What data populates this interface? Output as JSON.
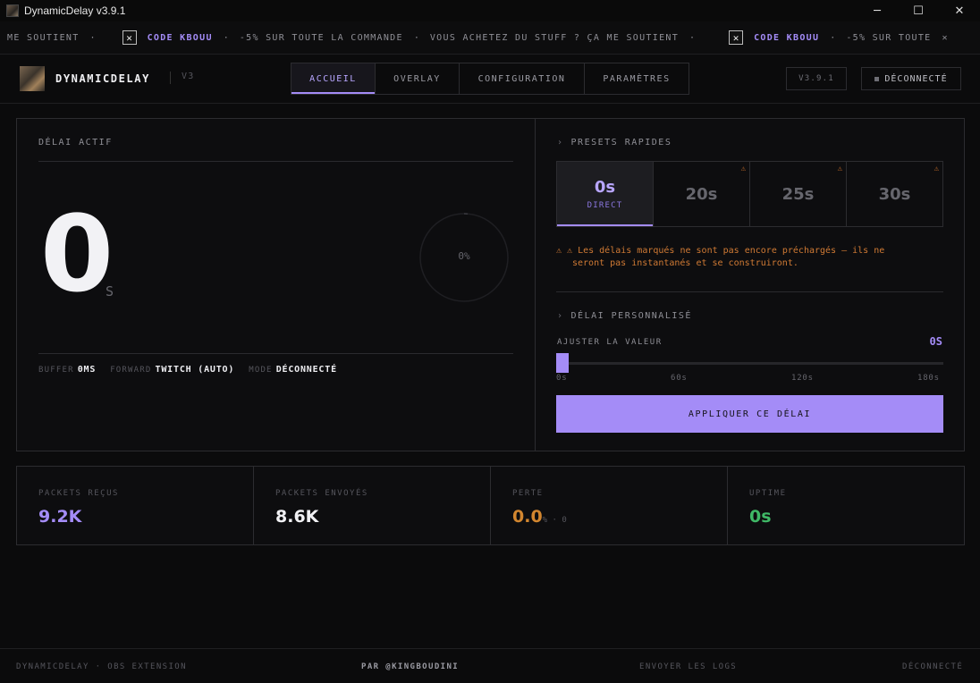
{
  "window": {
    "title": "DynamicDelay v3.9.1",
    "controls": {
      "minimize": "─",
      "maximize": "☐",
      "close": "✕"
    }
  },
  "ticker": {
    "lead": "ME SOUTIENT",
    "sep": "·",
    "code": "CODE KBOUU",
    "promo": "-5% SUR TOUTE LA COMMANDE",
    "support": "VOUS ACHETEZ DU STUFF ? ÇA ME SOUTIENT",
    "promo_cut": "-5% SUR TOUTE",
    "logo_glyph": "✕",
    "trail": "✕"
  },
  "header": {
    "brand": "DYNAMICDELAY",
    "brand_version": "V3",
    "tabs": [
      "ACCUEIL",
      "OVERLAY",
      "CONFIGURATION",
      "PARAMÈTRES"
    ],
    "active_tab": "ACCUEIL",
    "version": "V3.9.1",
    "status": "DÉCONNECTÉ"
  },
  "delay": {
    "label": "DÉLAI ACTIF",
    "value": "0",
    "unit": "S",
    "progress_text": "0%",
    "progress": 0,
    "buffer_label": "BUFFER",
    "buffer_value": "0MS",
    "forward_label": "FORWARD",
    "forward_value": "TWITCH (AUTO)",
    "mode_label": "MODE",
    "mode_value": "DÉCONNECTÉ"
  },
  "presets": {
    "label": "PRESETS RAPIDES",
    "chevron": "›",
    "items": [
      {
        "value": "0s",
        "sub": "DIRECT",
        "warn": ""
      },
      {
        "value": "20s",
        "sub": "",
        "warn": "⚠"
      },
      {
        "value": "25s",
        "sub": "",
        "warn": "⚠"
      },
      {
        "value": "30s",
        "sub": "",
        "warn": "⚠"
      }
    ],
    "warning_line1": "⚠ ⚠ Les délais marqués ne sont pas encore préchargés — ils ne",
    "warning_line2": "seront pas instantanés et se construiront."
  },
  "custom": {
    "label": "DÉLAI PERSONNALISÉ",
    "adjust_label": "AJUSTER LA VALEUR",
    "value": "0S",
    "slider_value": 0,
    "slider_max": 180,
    "ticks": [
      "0s",
      "60s",
      "120s",
      "180s"
    ],
    "apply": "APPLIQUER CE DÉLAI"
  },
  "stats": [
    {
      "label": "PACKETS REÇUS",
      "value": "9.2K",
      "color": "#a48cf7",
      "sub": ""
    },
    {
      "label": "PACKETS ENVOYÉS",
      "value": "8.6K",
      "color": "#f0f0f3",
      "sub": ""
    },
    {
      "label": "PERTE",
      "value": "0.0",
      "color": "#d2862f",
      "sub": "% · 0"
    },
    {
      "label": "UPTIME",
      "value": "0s",
      "color": "#3fb866",
      "sub": ""
    }
  ],
  "footer": {
    "left": "DYNAMICDELAY · OBS EXTENSION",
    "center": "PAR @KINGBOUDINI",
    "logs": "ENVOYER LES LOGS",
    "status": "DÉCONNECTÉ"
  },
  "colors": {
    "accent": "#a48cf7",
    "warning": "#d07a34",
    "success": "#3fb866",
    "background": "#0b0b0c"
  }
}
